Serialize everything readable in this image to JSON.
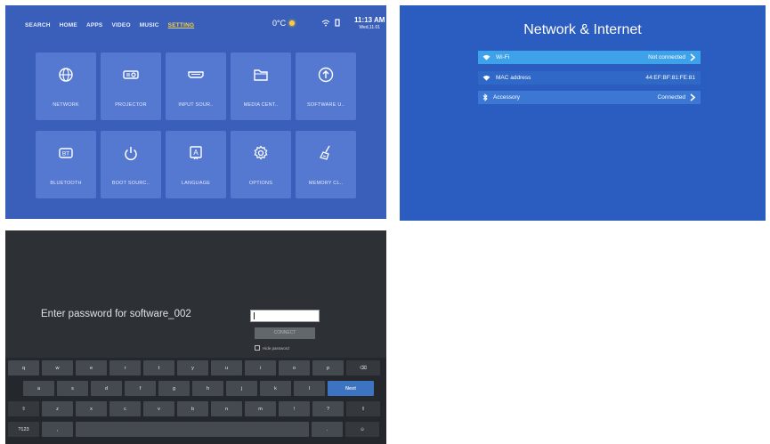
{
  "settings_home": {
    "nav": [
      "SEARCH",
      "HOME",
      "APPS",
      "VIDEO",
      "MUSIC",
      "SETTING"
    ],
    "active_nav": "SETTING",
    "weather": "0°C",
    "clock": {
      "time": "11:13 AM",
      "date": "Wed,11.01"
    },
    "tiles": [
      {
        "label": "NETWORK",
        "icon": "globe-icon"
      },
      {
        "label": "PROJECTOR",
        "icon": "projector-icon"
      },
      {
        "label": "INPUT SOUR..",
        "icon": "hdmi-icon"
      },
      {
        "label": "MEDIA CENT..",
        "icon": "folder-icon"
      },
      {
        "label": "SOFTWARE U..",
        "icon": "upload-arrow-icon"
      },
      {
        "label": "BLUETOOTH",
        "icon": "bluetooth-bt-icon"
      },
      {
        "label": "BOOT SOURC..",
        "icon": "power-icon"
      },
      {
        "label": "LANGUAGE",
        "icon": "language-a-icon"
      },
      {
        "label": "OPTIONS",
        "icon": "gear-icon"
      },
      {
        "label": "MEMORY CL..",
        "icon": "broom-icon"
      }
    ]
  },
  "network": {
    "title": "Network & Internet",
    "rows": [
      {
        "label": "Wi-Fi",
        "value": "Not connected",
        "icon": "wifi-icon",
        "chevron": true
      },
      {
        "label": "MAC address",
        "value": "44:EF:BF:81:FE:81",
        "icon": "wifi-icon",
        "chevron": false
      },
      {
        "label": "Accessory",
        "value": "Connected",
        "icon": "bluetooth-icon",
        "chevron": true
      }
    ]
  },
  "password": {
    "prompt": "Enter password for software_002",
    "connect_label": "CONNECT",
    "hide_label": "Hide password",
    "keyboard": {
      "row1": [
        "q",
        "w",
        "e",
        "r",
        "t",
        "y",
        "u",
        "i",
        "o",
        "p",
        "⌫"
      ],
      "row2": [
        "a",
        "s",
        "d",
        "f",
        "g",
        "h",
        "j",
        "k",
        "l",
        "Next"
      ],
      "row3": [
        "⇧",
        "z",
        "x",
        "c",
        "v",
        "b",
        "n",
        "m",
        "!",
        "?",
        "⇧"
      ],
      "row4": [
        "?123",
        ",",
        "",
        ".",
        "☺"
      ]
    }
  },
  "colors": {
    "settings_bg": "#3a5fba",
    "tile_bg": "#5579d0",
    "network_bg": "#2b5cbf",
    "row_highlight": "#3ea2ea",
    "keyboard_bg": "#24282c",
    "active_nav": "#f4d247"
  }
}
